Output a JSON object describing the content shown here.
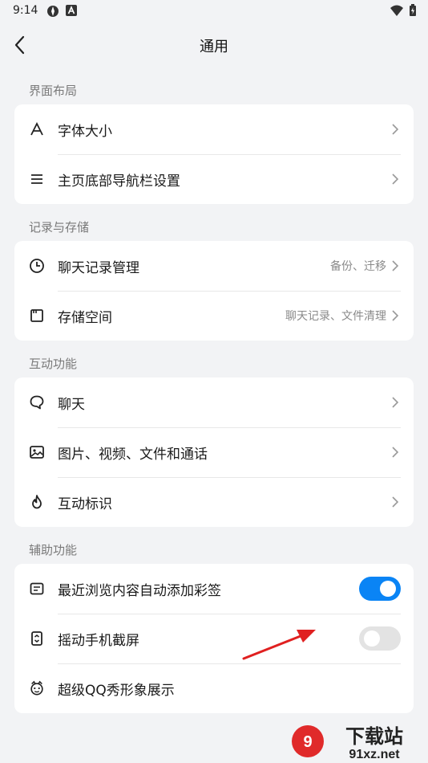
{
  "status_bar": {
    "time": "9:14"
  },
  "header": {
    "title": "通用"
  },
  "sections": [
    {
      "title": "界面布局",
      "items": [
        {
          "label": "字体大小",
          "value": ""
        },
        {
          "label": "主页底部导航栏设置",
          "value": ""
        }
      ]
    },
    {
      "title": "记录与存储",
      "items": [
        {
          "label": "聊天记录管理",
          "value": "备份、迁移"
        },
        {
          "label": "存储空间",
          "value": "聊天记录、文件清理"
        }
      ]
    },
    {
      "title": "互动功能",
      "items": [
        {
          "label": "聊天",
          "value": ""
        },
        {
          "label": "图片、视频、文件和通话",
          "value": ""
        },
        {
          "label": "互动标识",
          "value": ""
        }
      ]
    },
    {
      "title": "辅助功能",
      "items": [
        {
          "label": "最近浏览内容自动添加彩签",
          "toggle": true
        },
        {
          "label": "摇动手机截屏",
          "toggle": false
        },
        {
          "label": "超级QQ秀形象展示"
        }
      ]
    }
  ],
  "watermark": {
    "text_main": "下载站",
    "text_sub": "91xz.net"
  },
  "colors": {
    "accent": "#0a84f5",
    "annotation": "#e02020",
    "background": "#f2f3f5"
  },
  "icons": [
    "back-arrow-icon",
    "font-size-icon",
    "menu-lines-icon",
    "clock-icon",
    "storage-icon",
    "chat-bubble-icon",
    "image-icon",
    "flame-icon",
    "note-icon",
    "screenshot-icon",
    "qq-show-icon",
    "chevron-right-icon"
  ]
}
